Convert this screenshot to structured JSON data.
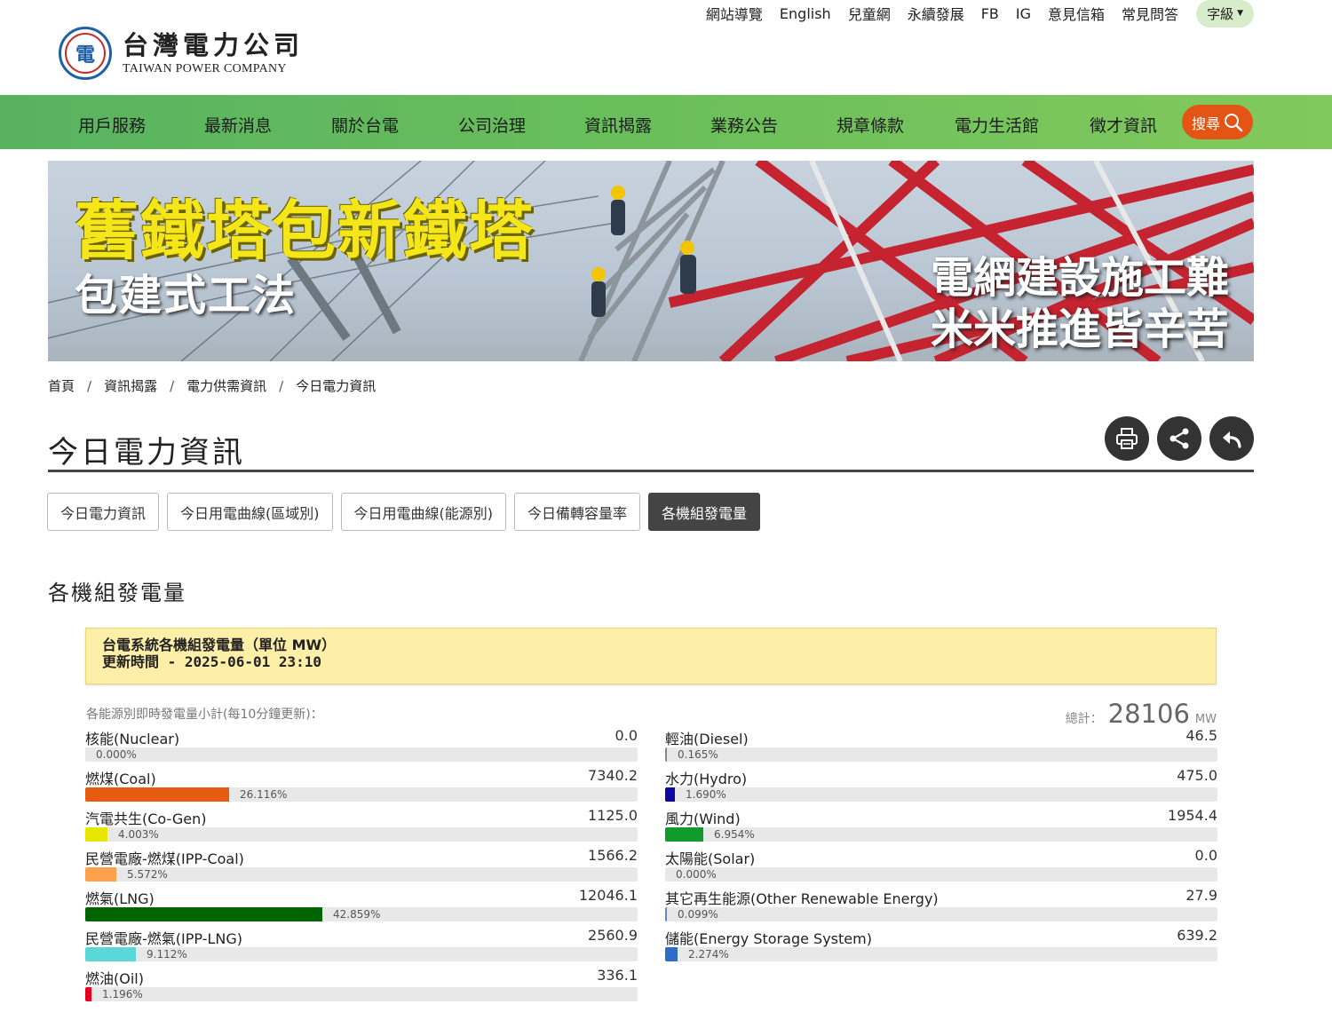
{
  "header": {
    "logo_cn": "台灣電力公司",
    "logo_en": "TAIWAN POWER COMPANY",
    "toplinks": [
      "網站導覽",
      "English",
      "兒童網",
      "永續發展",
      "FB",
      "IG",
      "意見信箱",
      "常見問答"
    ],
    "fontsize_label": "字級"
  },
  "nav": {
    "items": [
      "用戶服務",
      "最新消息",
      "關於台電",
      "公司治理",
      "資訊揭露",
      "業務公告",
      "規章條款",
      "電力生活館",
      "徵才資訊"
    ],
    "search_label": "搜尋"
  },
  "banner": {
    "title": "舊鐵塔包新鐵塔",
    "subtitle": "包建式工法",
    "right_line1": "電網建設施工難",
    "right_line2": "米米推進皆辛苦"
  },
  "breadcrumb": [
    "首頁",
    "資訊揭露",
    "電力供需資訊",
    "今日電力資訊"
  ],
  "page_title": "今日電力資訊",
  "tabs": [
    {
      "label": "今日電力資訊",
      "active": false
    },
    {
      "label": "今日用電曲線(區域別)",
      "active": false
    },
    {
      "label": "今日用電曲線(能源別)",
      "active": false
    },
    {
      "label": "今日備轉容量率",
      "active": false
    },
    {
      "label": "各機組發電量",
      "active": true
    }
  ],
  "section_title": "各機組發電量",
  "notice": {
    "line1": "台電系統各機組發電量（單位 MW）",
    "line2": "更新時間 - 2025-06-01 23:10"
  },
  "subtotal_note": "各能源別即時發電量小計(每10分鐘更新)：",
  "total": {
    "label": "總計：",
    "value": "28106",
    "unit": "MW"
  },
  "sources_left": [
    {
      "name": "核能(Nuclear)",
      "value": "0.0",
      "percent": "0.000%",
      "fraction": 0.0,
      "color": "#9e9e9e"
    },
    {
      "name": "燃煤(Coal)",
      "value": "7340.2",
      "percent": "26.116%",
      "fraction": 0.26116,
      "color": "#e55b0f"
    },
    {
      "name": "汽電共生(Co-Gen)",
      "value": "1125.0",
      "percent": "4.003%",
      "fraction": 0.04003,
      "color": "#e6e600"
    },
    {
      "name": "民營電廠-燃煤(IPP-Coal)",
      "value": "1566.2",
      "percent": "5.572%",
      "fraction": 0.05572,
      "color": "#ffa04d"
    },
    {
      "name": "燃氣(LNG)",
      "value": "12046.1",
      "percent": "42.859%",
      "fraction": 0.42859,
      "color": "#006400"
    },
    {
      "name": "民營電廠-燃氣(IPP-LNG)",
      "value": "2560.9",
      "percent": "9.112%",
      "fraction": 0.09112,
      "color": "#5ad8d8"
    },
    {
      "name": "燃油(Oil)",
      "value": "336.1",
      "percent": "1.196%",
      "fraction": 0.01196,
      "color": "#e8001c"
    }
  ],
  "sources_right": [
    {
      "name": "輕油(Diesel)",
      "value": "46.5",
      "percent": "0.165%",
      "fraction": 0.00165,
      "color": "#888888"
    },
    {
      "name": "水力(Hydro)",
      "value": "475.0",
      "percent": "1.690%",
      "fraction": 0.0169,
      "color": "#0a0aa0"
    },
    {
      "name": "風力(Wind)",
      "value": "1954.4",
      "percent": "6.954%",
      "fraction": 0.06954,
      "color": "#119b2a"
    },
    {
      "name": "太陽能(Solar)",
      "value": "0.0",
      "percent": "0.000%",
      "fraction": 0.0,
      "color": "#ffcc00"
    },
    {
      "name": "其它再生能源(Other Renewable Energy)",
      "value": "27.9",
      "percent": "0.099%",
      "fraction": 0.00099,
      "color": "#6688cc"
    },
    {
      "name": "儲能(Energy Storage System)",
      "value": "639.2",
      "percent": "2.274%",
      "fraction": 0.02274,
      "color": "#2f6cc7"
    }
  ]
}
